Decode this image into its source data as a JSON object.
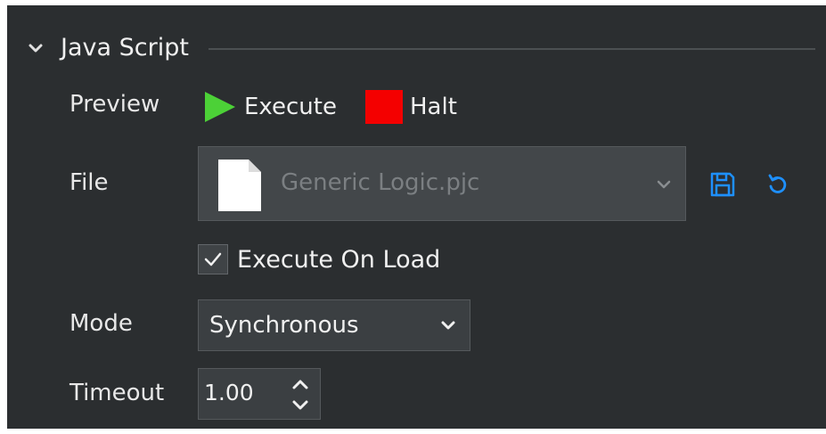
{
  "section": {
    "title": "Java Script",
    "icon": "chevron-down-icon"
  },
  "preview": {
    "label": "Preview",
    "execute_label": "Execute",
    "execute_icon": "play-icon",
    "halt_label": "Halt",
    "halt_icon": "stop-icon",
    "execute_color": "#4cd137",
    "halt_color": "#f40000"
  },
  "file": {
    "label": "File",
    "value": "Generic Logic.pjc",
    "file_icon": "document-icon",
    "save_icon": "save-icon",
    "reload_icon": "reload-icon",
    "accent_color": "#1e90ff"
  },
  "execute_on_load": {
    "label": "Execute On Load",
    "checked": true
  },
  "mode": {
    "label": "Mode",
    "value": "Synchronous"
  },
  "timeout": {
    "label": "Timeout",
    "value": "1.00"
  }
}
